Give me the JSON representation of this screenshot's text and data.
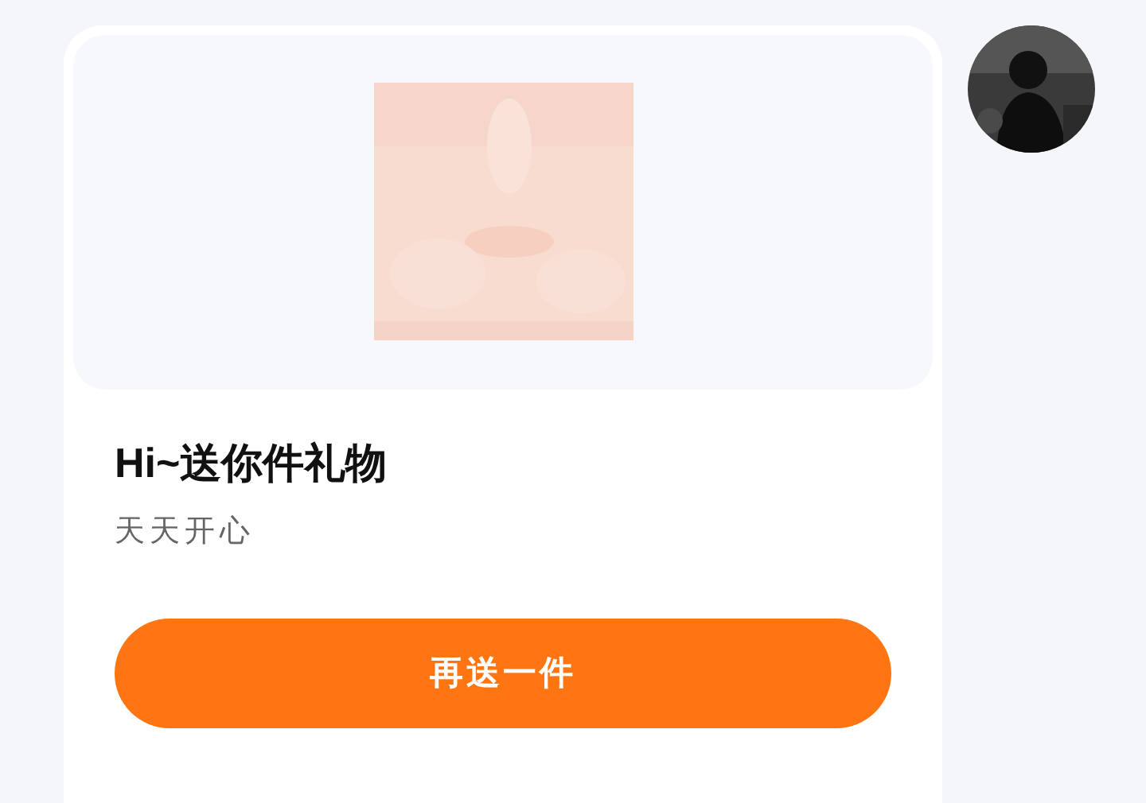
{
  "gift_card": {
    "title": "Hi~送你件礼物",
    "subtitle": "天天开心",
    "button": "再送一件"
  }
}
